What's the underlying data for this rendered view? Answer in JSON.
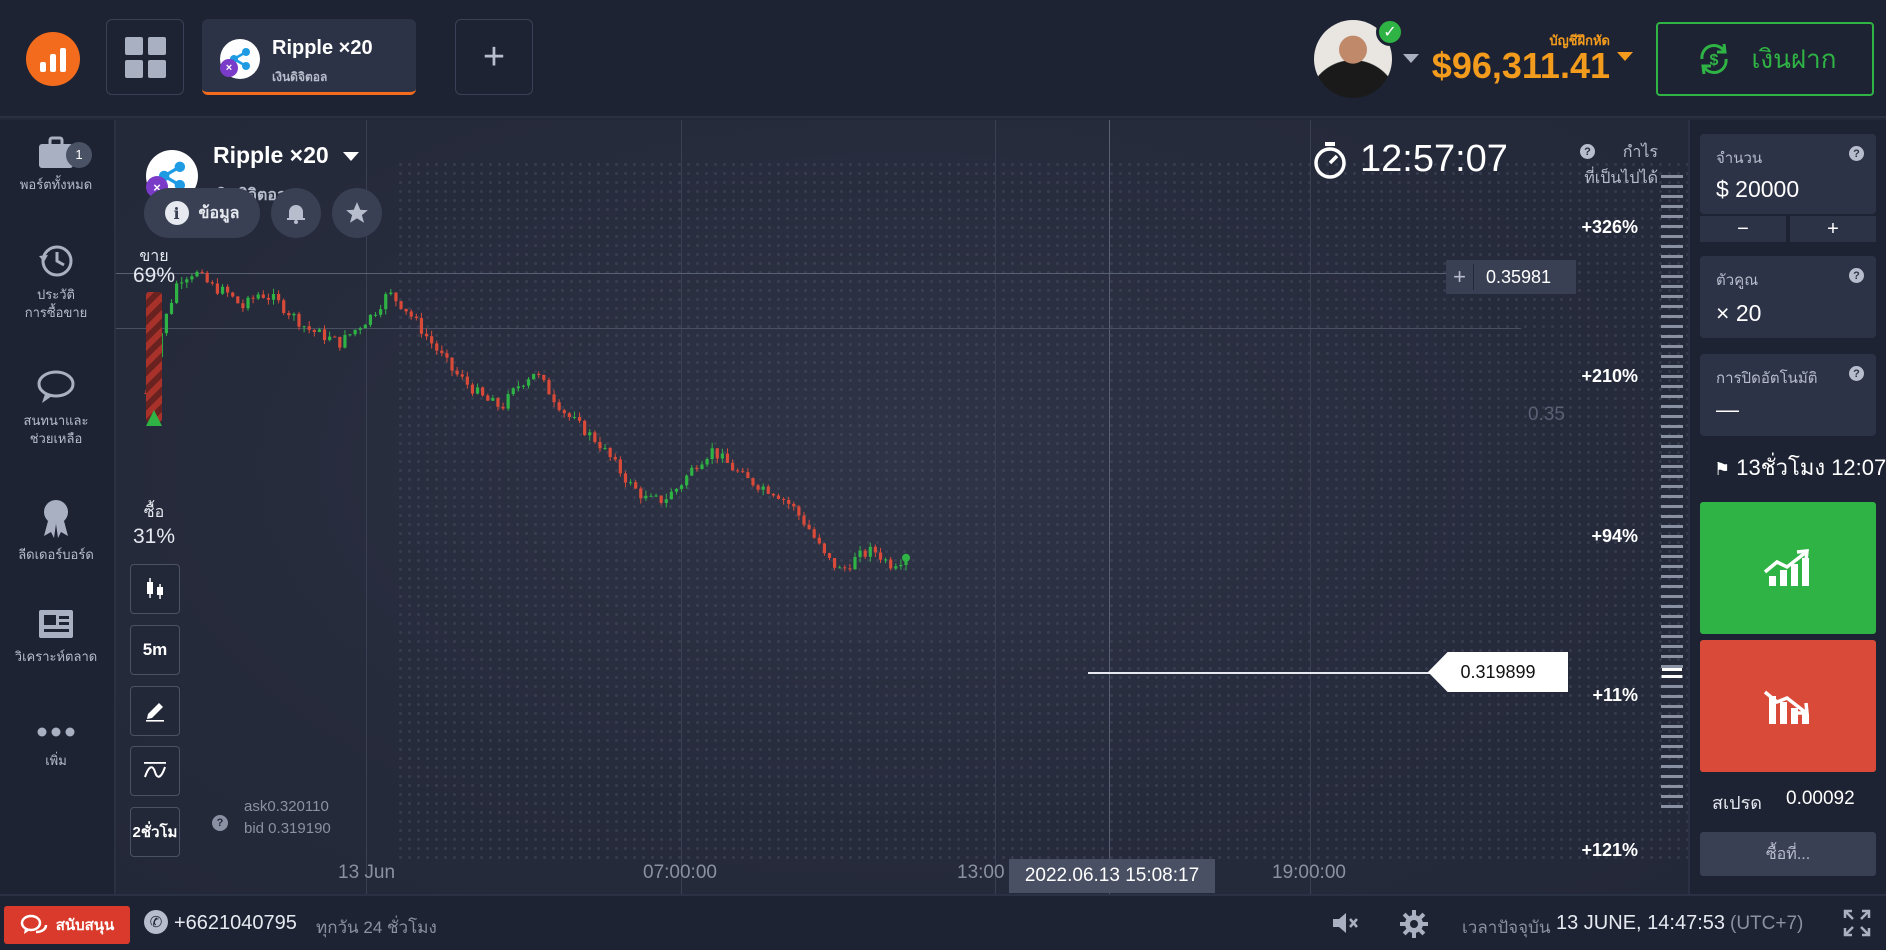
{
  "topbar": {
    "asset_tab_name": "Ripple ×20",
    "asset_tab_sub": "เงินดิจิตอล",
    "add_tab_label": "+",
    "account_label": "บัญชีฝึกหัด",
    "balance": "$96,311.41",
    "deposit_label": "เงินฝาก"
  },
  "sidebar": {
    "items": [
      {
        "label_1": "พอร์ตทั้งหมด",
        "icon": "briefcase-icon",
        "badge": "1"
      },
      {
        "label_1": "ประวัติ",
        "label_2": "การซื้อขาย",
        "icon": "history-icon"
      },
      {
        "label_1": "สนทนาและ",
        "label_2": "ช่วยเหลือ",
        "icon": "chat-icon"
      },
      {
        "label_1": "ลีดเดอร์บอร์ด",
        "icon": "award-icon"
      },
      {
        "label_1": "วิเคราะห์ตลาด",
        "icon": "news-icon"
      },
      {
        "label_1": "เพิ่ม",
        "icon": "more-icon"
      }
    ]
  },
  "chart_header": {
    "asset_name": "Ripple ×20",
    "asset_type": "เงินดิจิตอล",
    "info_label": "ข้อมูล"
  },
  "sentiment": {
    "sell_label": "ขาย",
    "sell_pct": "69%",
    "buy_label": "ซื้อ",
    "buy_pct": "31%"
  },
  "tools": {
    "interval": "5m",
    "period": "2ชั่วโม"
  },
  "timer": "12:57:07",
  "profit_label_1": "กำไร",
  "profit_label_2": "ที่เป็นไปได้",
  "profit_levels": [
    "+326%",
    "+210%",
    "+94%",
    "+11%",
    "+121%"
  ],
  "price_marker": "0.35981",
  "price_gridline": "0.35",
  "current_price": "0.319899",
  "ask": "ask0.320110",
  "bid": "bid 0.319190",
  "time_axis": {
    "ticks": [
      "13 Jun",
      "07:00:00",
      "13:00",
      "19:00:00"
    ],
    "cursor_time": "2022.06.13 15:08:17"
  },
  "chart_data": {
    "type": "candlestick",
    "x_ticks": [
      "13 Jun",
      "07:00:00",
      "13:00",
      "19:00:00"
    ],
    "y_reference": [
      0.35,
      0.35981
    ],
    "last_price": 0.319899,
    "close_trend": [
      0.343,
      0.352,
      0.359,
      0.36,
      0.358,
      0.357,
      0.355,
      0.357,
      0.356,
      0.354,
      0.352,
      0.351,
      0.35,
      0.352,
      0.354,
      0.357,
      0.355,
      0.352,
      0.349,
      0.346,
      0.344,
      0.342,
      0.341,
      0.344,
      0.346,
      0.343,
      0.34,
      0.338,
      0.336,
      0.333,
      0.33,
      0.328,
      0.328,
      0.33,
      0.333,
      0.335,
      0.333,
      0.331,
      0.33,
      0.329,
      0.327,
      0.324,
      0.32,
      0.318,
      0.32,
      0.321,
      0.319,
      0.32
    ]
  },
  "rpanel": {
    "amount_label": "จำนวน",
    "amount_value": "$  20000",
    "minus": "−",
    "plus": "+",
    "multiplier_label": "ตัวคูณ",
    "multiplier_value": "× 20",
    "autoclose_label": "การปิดอัตโนมัติ",
    "autoclose_value": "—",
    "expiry": "13ชั่วโมง 12:07",
    "spread_label": "สเปรด",
    "spread_value": "0.00092",
    "more_label": "ซื้อที่..."
  },
  "bottombar": {
    "support_label": "สนับสนุน",
    "phone": "+6621040795",
    "hours": "ทุกวัน 24 ชั่วโมง",
    "time_label": "เวลาปัจจุบัน",
    "time_value": "13 JUNE, 14:47:53",
    "tz": "(UTC+7)"
  },
  "colors": {
    "accent": "#f36b1c",
    "balance": "#f39b1c",
    "up": "#2fb344",
    "down": "#d94a38"
  }
}
